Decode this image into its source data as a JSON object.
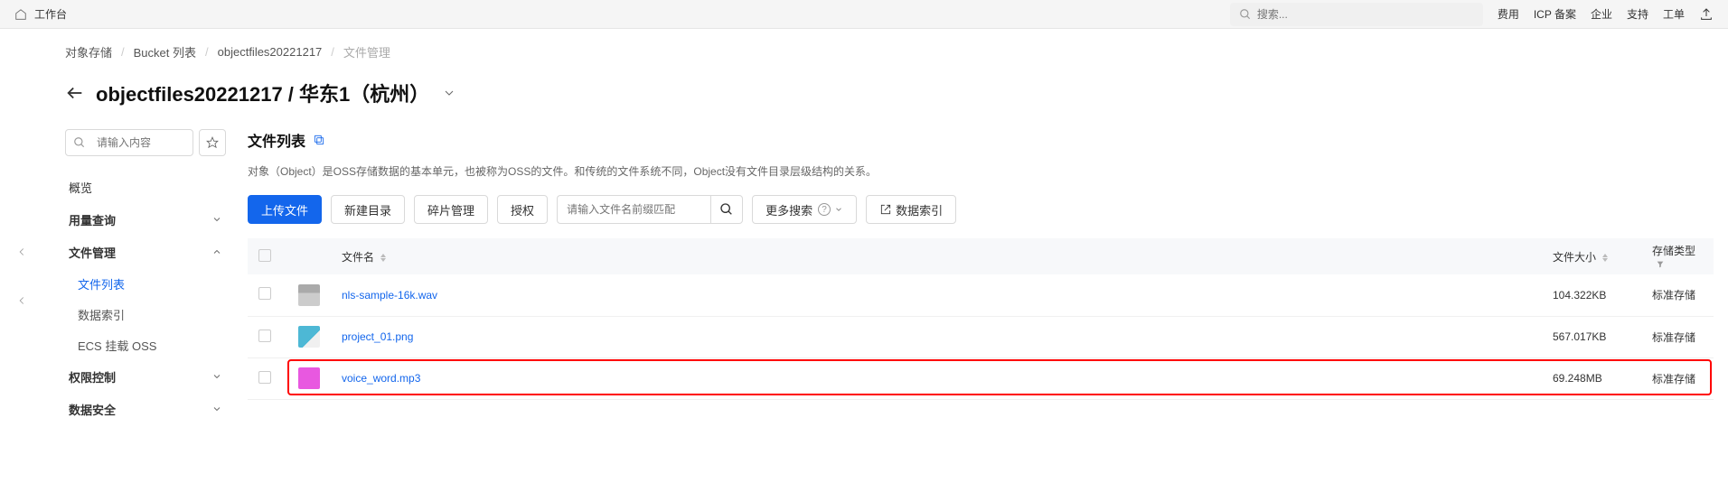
{
  "topbar": {
    "home_label": "工作台",
    "search_placeholder": "搜索...",
    "links": [
      "费用",
      "ICP 备案",
      "企业",
      "支持",
      "工单"
    ]
  },
  "breadcrumb": {
    "items": [
      "对象存储",
      "Bucket 列表",
      "objectfiles20221217",
      "文件管理"
    ]
  },
  "page": {
    "title": "objectfiles20221217 / 华东1（杭州）"
  },
  "sidebar": {
    "search_placeholder": "请输入内容",
    "items": [
      {
        "type": "plain",
        "label": "概览"
      },
      {
        "type": "expandable",
        "label": "用量查询",
        "expanded": false
      },
      {
        "type": "expandable",
        "label": "文件管理",
        "expanded": true,
        "children": [
          {
            "label": "文件列表",
            "active": true
          },
          {
            "label": "数据索引",
            "active": false
          },
          {
            "label": "ECS 挂载 OSS",
            "active": false
          }
        ]
      },
      {
        "type": "expandable",
        "label": "权限控制",
        "expanded": false
      },
      {
        "type": "expandable",
        "label": "数据安全",
        "expanded": false
      }
    ]
  },
  "main": {
    "panel_title": "文件列表",
    "description": "对象（Object）是OSS存储数据的基本单元，也被称为OSS的文件。和传统的文件系统不同，Object没有文件目录层级结构的关系。",
    "actions": {
      "upload": "上传文件",
      "mkdir": "新建目录",
      "fragment": "碎片管理",
      "auth": "授权",
      "prefix_placeholder": "请输入文件名前缀匹配",
      "more_search": "更多搜索",
      "data_index": "数据索引"
    },
    "columns": {
      "filename": "文件名",
      "filesize": "文件大小",
      "storage_type": "存储类型"
    },
    "rows": [
      {
        "icon": "wav",
        "name": "nls-sample-16k.wav",
        "size": "104.322KB",
        "storage": "标准存储",
        "highlighted": false
      },
      {
        "icon": "png",
        "name": "project_01.png",
        "size": "567.017KB",
        "storage": "标准存储",
        "highlighted": false
      },
      {
        "icon": "mp3",
        "name": "voice_word.mp3",
        "size": "69.248MB",
        "storage": "标准存储",
        "highlighted": true
      }
    ]
  }
}
